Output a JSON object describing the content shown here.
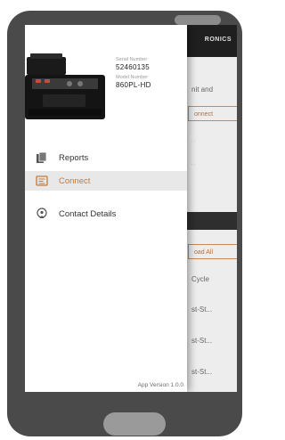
{
  "app": {
    "brand": "RONICS",
    "background_texts": {
      "line1": "nit and",
      "button1": "onnect",
      "button2": "oad All",
      "cycle": "Cycle",
      "row1": "st-St...",
      "row2": "st-St...",
      "row3": "st-St..."
    }
  },
  "drawer": {
    "serial_label": "Serial Number",
    "serial_value": "52460135",
    "model_label": "Model Number",
    "model_value": "860PL-HD",
    "menu": [
      {
        "label": "Reports",
        "icon": "reports-icon",
        "active": false
      },
      {
        "label": "Connect",
        "icon": "connect-icon",
        "active": true
      },
      {
        "label": "Contact Details",
        "icon": "contact-icon",
        "active": false
      }
    ],
    "version": "App Version 1.0.0"
  },
  "colors": {
    "accent": "#c17a3f",
    "appbar": "#1f1f1f",
    "phone": "#4a4a4a"
  }
}
